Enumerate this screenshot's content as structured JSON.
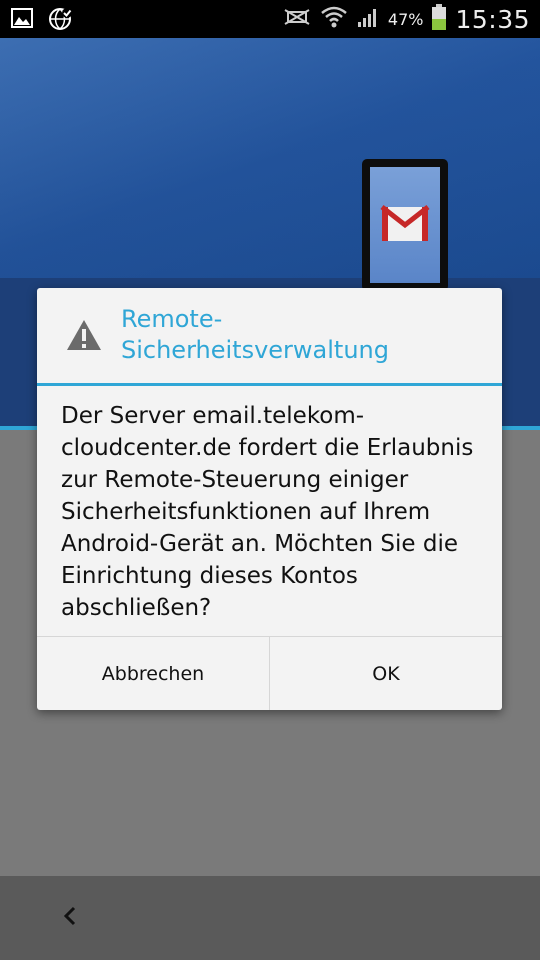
{
  "status_bar": {
    "battery_percent": "47%",
    "time": "15:35",
    "left_icons": [
      "gallery-icon",
      "globe-sync-icon"
    ],
    "right_icons": [
      "nfc-muted-icon",
      "wifi-icon",
      "signal-icon",
      "battery-icon"
    ]
  },
  "dialog": {
    "title": "Remote-Sicherheitsverwaltung",
    "icon": "warning-icon",
    "message": "Der Server email.telekom-cloudcenter.de fordert die Erlaubnis zur Remote-Steuerung einiger Sicherheitsfunktionen auf Ihrem Android-Gerät an. Möchten Sie die Einrichtung dieses Kontos abschließen?",
    "cancel_label": "Abbrechen",
    "ok_label": "OK"
  },
  "navigation": {
    "back_icon": "chevron-left-icon"
  },
  "colors": {
    "accent": "#2fa6d6",
    "background_blue": "#1d4e96",
    "dialog_bg": "#f3f3f3"
  }
}
